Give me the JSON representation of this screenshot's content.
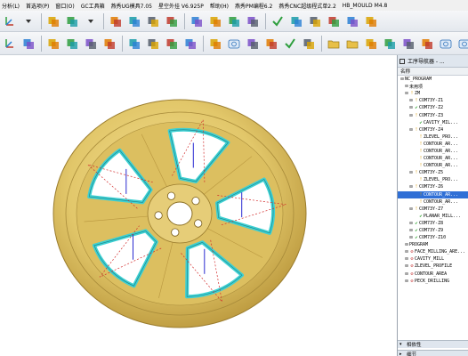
{
  "menu": [
    "分析(L)",
    "首选项(P)",
    "窗口(O)",
    "GC工具箱",
    "燕秀UG模具7.05",
    "星空外挂 V6.925P",
    "帮助(H)",
    "燕秀PM编程6.2",
    "燕秀CNC超级程式单2.2",
    "HB_MOULD M4.8"
  ],
  "toolbar_row1_icons": [
    "axis-triad-icon",
    "dropdown-icon",
    "fit-view-icon",
    "shaded-render-icon",
    "dropdown-icon",
    "gc-toolbox-icon",
    "yanxiu-mold-icon",
    "mold-wizard-icon",
    "spring-icon",
    "pencil-icon",
    "hatch-icon",
    "save-icon",
    "measure-icon",
    "check-mark-icon",
    "play-icon",
    "stop-icon",
    "sketch-icon",
    "cut-icon",
    "layer-icon"
  ],
  "toolbar_row2_icons": [
    "axis-triad-icon",
    "cube-icon",
    "generate-path-icon",
    "layer-settings-icon",
    "tool-library-icon",
    "verify-icon",
    "postprocess-icon",
    "paint-bucket-icon",
    "shop-doc-icon",
    "stack-icon",
    "model-icon",
    "cylinder-icon",
    "grid-icon",
    "list-icon",
    "check-icon",
    "table-icon",
    "open-folder-icon",
    "save-folder-icon",
    "note-icon",
    "save-as-icon",
    "view-layout-icon",
    "mirror-icon",
    "recent-icon",
    "camera-icon"
  ],
  "navigator": {
    "title": "工序导航器 - ...",
    "column": "名称",
    "items": [
      {
        "indent": 0,
        "mark": "",
        "label": "NC_PROGRAM"
      },
      {
        "indent": 1,
        "mark": "",
        "label": "未用项"
      },
      {
        "indent": 1,
        "mark": "pend",
        "label": "ZM"
      },
      {
        "indent": 2,
        "mark": "pend",
        "label": "COM73Y-Z1"
      },
      {
        "indent": 2,
        "mark": "check",
        "label": "COM73Y-Z2"
      },
      {
        "indent": 2,
        "mark": "pend",
        "label": "COM73Y-Z3"
      },
      {
        "indent": 3,
        "mark": "check",
        "label": "CAVITY_MIL..."
      },
      {
        "indent": 2,
        "mark": "pend",
        "label": "COM73Y-Z4"
      },
      {
        "indent": 3,
        "mark": "pend",
        "label": "ZLEVEL_PRO..."
      },
      {
        "indent": 3,
        "mark": "pend",
        "label": "CONTOUR_AR..."
      },
      {
        "indent": 3,
        "mark": "pend",
        "label": "CONTOUR_AR..."
      },
      {
        "indent": 3,
        "mark": "pend",
        "label": "CONTOUR_AR..."
      },
      {
        "indent": 3,
        "mark": "pend",
        "label": "CONTOUR_AR..."
      },
      {
        "indent": 2,
        "mark": "pend",
        "label": "COM73Y-Z5"
      },
      {
        "indent": 3,
        "mark": "pend",
        "label": "ZLEVEL_PRO..."
      },
      {
        "indent": 2,
        "mark": "pend",
        "label": "COM73Y-Z6"
      },
      {
        "indent": 3,
        "mark": "pend",
        "label": "CONTOUR_AR...",
        "selected": true
      },
      {
        "indent": 3,
        "mark": "pend",
        "label": "CONTOUR_AR..."
      },
      {
        "indent": 2,
        "mark": "pend",
        "label": "COM73Y-Z7"
      },
      {
        "indent": 3,
        "mark": "check",
        "label": "PLANAR_MILL..."
      },
      {
        "indent": 2,
        "mark": "check",
        "label": "COM73Y-Z8"
      },
      {
        "indent": 2,
        "mark": "check",
        "label": "COM73Y-Z9"
      },
      {
        "indent": 2,
        "mark": "check",
        "label": "COM73Y-Z10"
      },
      {
        "indent": 1,
        "mark": "",
        "label": "PROGRAM"
      },
      {
        "indent": 1,
        "mark": "nok",
        "label": "FACE_MILLING_ARE..."
      },
      {
        "indent": 1,
        "mark": "nok",
        "label": "CAVITY_MILL"
      },
      {
        "indent": 1,
        "mark": "nok",
        "label": "ZLEVEL_PROFILE"
      },
      {
        "indent": 1,
        "mark": "nok",
        "label": "CONTOUR_AREA"
      },
      {
        "indent": 1,
        "mark": "nok",
        "label": "PECK_DRILLING"
      }
    ],
    "sections": [
      "相依性",
      "细节"
    ]
  },
  "colors": {
    "wheel_gold": "#e2c76a",
    "wheel_shade": "#c9a94a",
    "toolpath_cyan": "#3ed0d2",
    "path_red": "#d22a2a",
    "path_blue": "#2a2ad0",
    "selection": "#2f6fd6"
  }
}
